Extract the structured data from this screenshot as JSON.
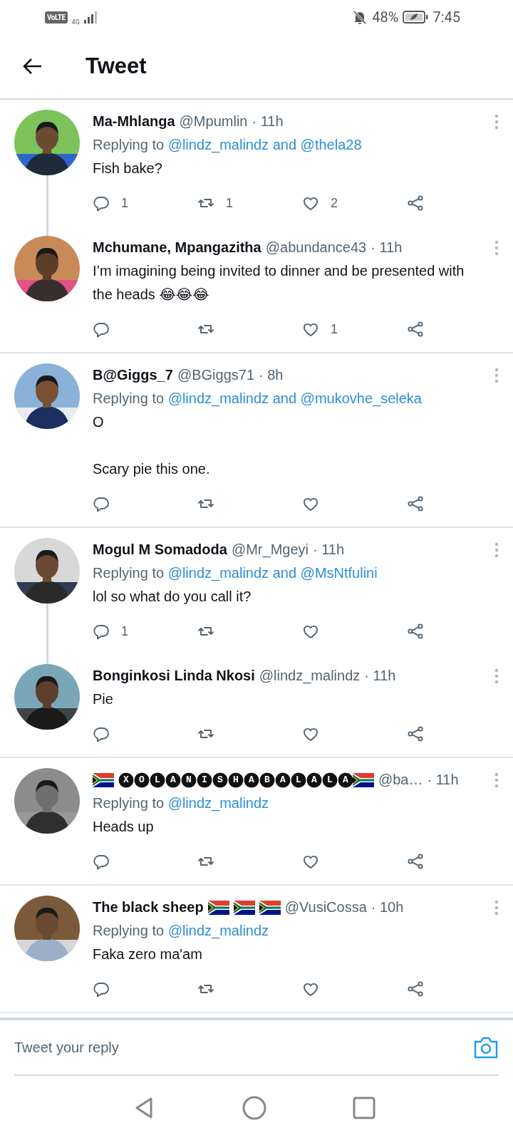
{
  "status_bar": {
    "network_badge": "VoLTE",
    "network_type": "4G",
    "battery": "48%",
    "time": "7:45"
  },
  "header": {
    "title": "Tweet"
  },
  "threads": [
    {
      "tweets": [
        {
          "name": [
            {
              "kind": "text",
              "text": "Ma-Mhlanga"
            }
          ],
          "handle": "@Mpumlin",
          "time": "· 11h",
          "replying_to": {
            "prefix": "Replying to",
            "mentions": "@lindz_malindz and @thela28"
          },
          "body": [
            [
              {
                "kind": "text",
                "text": "Fish bake?"
              }
            ]
          ],
          "counts": {
            "reply": "1",
            "retweet": "1",
            "like": "2"
          }
        },
        {
          "name": [
            {
              "kind": "text",
              "text": "Mchumane, Mpangazitha"
            }
          ],
          "handle": "@abundance43",
          "time": "· 11h",
          "body": [
            [
              {
                "kind": "text",
                "text": "I’m imagining being invited to dinner and be presented with the heads 😂😂😂"
              }
            ]
          ],
          "counts": {
            "like": "1"
          }
        }
      ]
    },
    {
      "tweets": [
        {
          "name": [
            {
              "kind": "text",
              "text": "B@Giggs_7"
            }
          ],
          "handle": "@BGiggs71",
          "time": "· 8h",
          "replying_to": {
            "prefix": "Replying to",
            "mentions": "@lindz_malindz and @mukovhe_seleka"
          },
          "body": [
            [
              {
                "kind": "text",
                "text": "O"
              }
            ],
            [
              {
                "kind": "text",
                "text": "Scary pie this one."
              }
            ]
          ]
        }
      ]
    },
    {
      "tweets": [
        {
          "name": [
            {
              "kind": "text",
              "text": "Mogul M Somadoda"
            }
          ],
          "handle": "@Mr_Mgeyi",
          "time": "· 11h",
          "replying_to": {
            "prefix": "Replying to",
            "mentions": "@lindz_malindz and @MsNtfulini"
          },
          "body": [
            [
              {
                "kind": "text",
                "text": "lol so what do you call it?"
              }
            ]
          ],
          "counts": {
            "reply": "1"
          }
        },
        {
          "name": [
            {
              "kind": "text",
              "text": "Bonginkosi Linda Nkosi"
            }
          ],
          "handle": "@lindz_malindz",
          "time": "· 11h",
          "body": [
            [
              {
                "kind": "text",
                "text": "Pie"
              }
            ]
          ]
        }
      ]
    },
    {
      "tweets": [
        {
          "name": [
            {
              "kind": "flag"
            },
            {
              "kind": "circled",
              "text": "XOLANISHABALALA"
            },
            {
              "kind": "flag"
            }
          ],
          "handle": "@ba…",
          "time": "· 11h",
          "replying_to": {
            "prefix": "Replying to",
            "mentions": "@lindz_malindz"
          },
          "body": [
            [
              {
                "kind": "text",
                "text": "Heads up"
              }
            ]
          ]
        }
      ]
    },
    {
      "tweets": [
        {
          "name": [
            {
              "kind": "text",
              "text": "The black sheep"
            },
            {
              "kind": "flag"
            },
            {
              "kind": "flag"
            },
            {
              "kind": "flag"
            }
          ],
          "handle": "@VusiCossa",
          "time": "· 10h",
          "replying_to": {
            "prefix": "Replying to",
            "mentions": "@lindz_malindz"
          },
          "body": [
            [
              {
                "kind": "text",
                "text": "Faka zero ma'am"
              }
            ]
          ]
        }
      ]
    }
  ],
  "reply_box": {
    "placeholder": "Tweet your reply"
  }
}
